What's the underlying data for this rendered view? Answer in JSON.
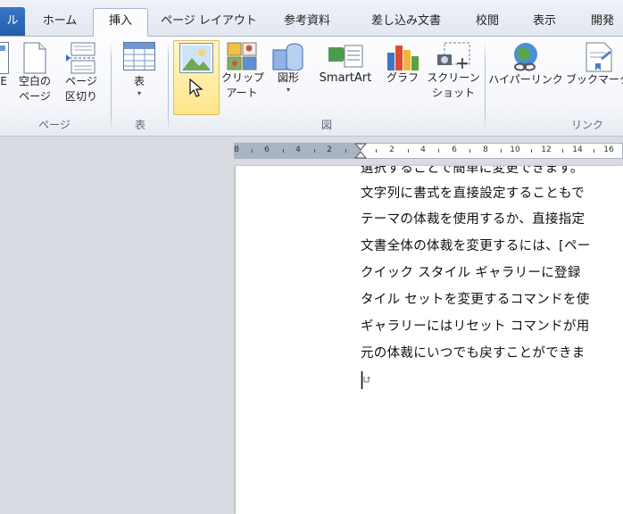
{
  "tabs": [
    {
      "label": "ル",
      "file": true
    },
    {
      "label": "ホーム"
    },
    {
      "label": "挿入",
      "active": true
    },
    {
      "label": "ページ レイアウト"
    },
    {
      "label": "参考資料"
    },
    {
      "label": "差し込み文書"
    },
    {
      "label": "校閲"
    },
    {
      "label": "表示"
    },
    {
      "label": "開発"
    }
  ],
  "ribbon": {
    "groups": {
      "page": "ページ",
      "table": "表",
      "figure": "図",
      "link": "リンク"
    },
    "buttons": {
      "cover_partial": "E",
      "blank_page_line1": "空白の",
      "blank_page_line2": "ページ",
      "page_break_line1": "ページ",
      "page_break_line2": "区切り",
      "table": "表",
      "clipart_line1": "クリップ",
      "clipart_line2": "アート",
      "shapes": "図形",
      "smartart": "SmartArt",
      "chart": "グラフ",
      "screenshot_line1": "スクリーン",
      "screenshot_line2": "ショット",
      "hyperlink": "ハイパーリンク",
      "bookmark": "ブックマーク"
    }
  },
  "ruler": {
    "labels_left": [
      "8",
      "6",
      "4",
      "2"
    ],
    "labels_right": [
      "2",
      "4",
      "6",
      "8",
      "10",
      "12",
      "14",
      "16"
    ]
  },
  "document": {
    "lines": [
      "選択することで簡単に変更できます。",
      "文字列に書式を直接設定することもで",
      "テーマの体裁を使用するか、直接指定",
      "文書全体の体裁を変更するには、[ペー",
      "クイック スタイル ギャラリーに登録",
      "タイル セットを変更するコマンドを使",
      "ギャラリーにはリセット コマンドが用",
      "元の体裁にいつでも戻すことができま"
    ]
  },
  "colors": {
    "file_tab": "#2b63ae",
    "hover_fill": "#ffe58a",
    "hover_border": "#e3bd5b"
  }
}
